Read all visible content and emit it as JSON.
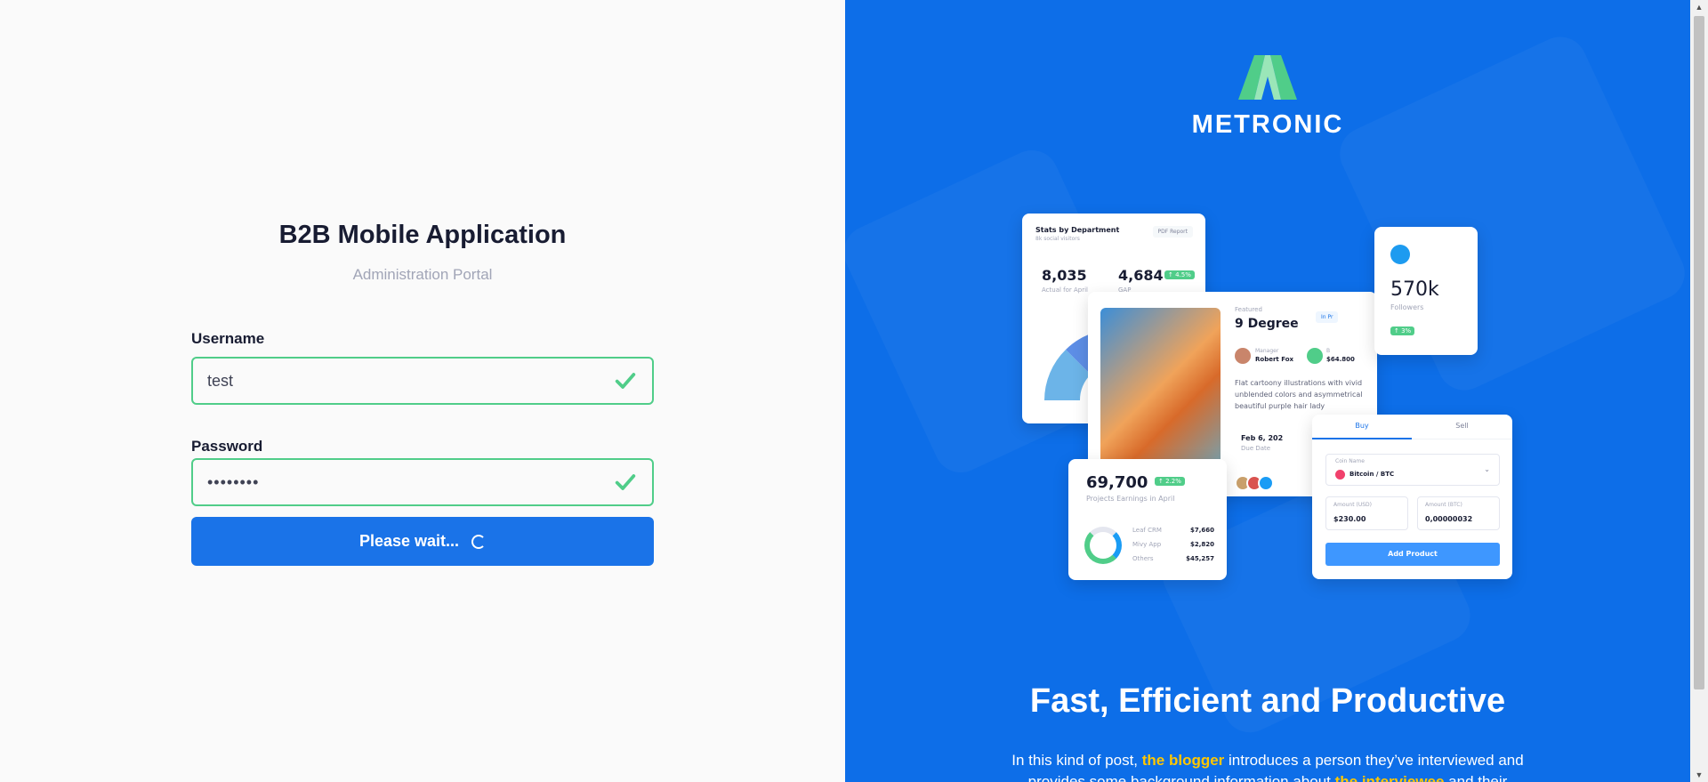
{
  "login": {
    "title": "B2B Mobile Application",
    "subtitle": "Administration Portal",
    "username_label": "Username",
    "username_value": "test",
    "password_label": "Password",
    "password_value": "••••••••",
    "submit_label": "Please wait..."
  },
  "brand": {
    "name": "METRONIC",
    "tagline": "Fast, Efficient and Productive",
    "desc_part1": "In this kind of post, ",
    "desc_link1": "the blogger",
    "desc_part2": "  introduces a person they’ve interviewed and provides some background information about ",
    "desc_link2": "the interviewee",
    "desc_part3": " and their"
  },
  "mockup": {
    "stats_title": "Stats by Department",
    "stats_sub": "8k social visitors",
    "stats_btn": "PDF Report",
    "stat1_value": "8,035",
    "stat1_label": "Actual for April",
    "stat2_value": "4,684",
    "stat2_badge": "↑ 4.5%",
    "stat2_label": "GAP",
    "featured_label": "Featured",
    "featured_title": "9 Degree",
    "featured_pill": "In Pr",
    "manager_label": "Manager",
    "manager_name": "Robert Fox",
    "budget_label": "B",
    "budget_value": "$64.800",
    "featured_desc": "Flat cartoony illustrations with vivid unblended colors and asymmetrical beautiful purple hair lady",
    "due_date": "Feb 6, 202",
    "due_label": "Due Date",
    "twitter_value": "570k",
    "twitter_label": "Followers",
    "twitter_badge": "↑ 3%",
    "earn_value": "69,700",
    "earn_badge": "↑ 2.2%",
    "earn_label": "Projects Earnings in April",
    "earn_rows": [
      {
        "name": "Leaf CRM",
        "value": "$7,660"
      },
      {
        "name": "Mivy App",
        "value": "$2,820"
      },
      {
        "name": "Others",
        "value": "$45,257"
      }
    ],
    "tab_buy": "Buy",
    "tab_sell": "Sell",
    "coin_label": "Coin Name",
    "coin_value": "Bitcoin / BTC",
    "usd_label": "Amount (USD)",
    "usd_value": "$230.00",
    "btc_label": "Amount (BTC)",
    "btc_value": "0,00000032",
    "add_btn": "Add Product"
  },
  "colors": {
    "accent": "#1a73e8",
    "success": "#50cd89",
    "brand_bg": "#0d6ee8",
    "highlight": "#ffc700"
  }
}
